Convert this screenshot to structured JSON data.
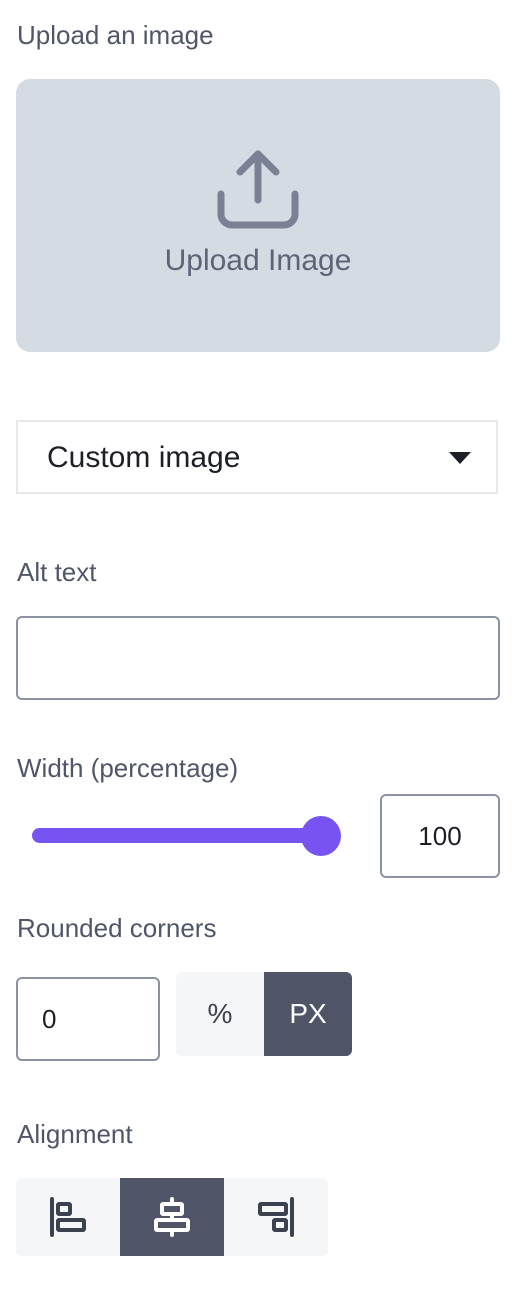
{
  "upload": {
    "section_label": "Upload an image",
    "button_label": "Upload Image",
    "icon": "upload-icon"
  },
  "source_select": {
    "value": "Custom image",
    "icon": "caret-down-icon"
  },
  "alt_text": {
    "label": "Alt text",
    "value": ""
  },
  "width": {
    "label": "Width (percentage)",
    "value": "100",
    "slider_percent": 100
  },
  "rounded_corners": {
    "label": "Rounded corners",
    "value": "0",
    "units": [
      {
        "label": "%",
        "selected": false
      },
      {
        "label": "PX",
        "selected": true
      }
    ]
  },
  "alignment": {
    "label": "Alignment",
    "options": [
      {
        "icon": "align-left-icon",
        "selected": false
      },
      {
        "icon": "align-center-icon",
        "selected": true
      },
      {
        "icon": "align-right-icon",
        "selected": false
      }
    ]
  },
  "colors": {
    "accent": "#7754f2",
    "active_button": "#4f5467",
    "upload_bg": "#d5dbe3"
  }
}
